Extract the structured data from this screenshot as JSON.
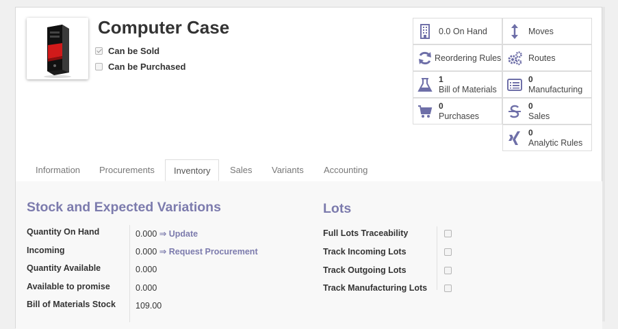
{
  "product": {
    "name": "Computer Case",
    "can_be_sold_label": "Can be Sold",
    "can_be_sold": true,
    "can_be_purchased_label": "Can be Purchased",
    "can_be_purchased": false
  },
  "smart_buttons": {
    "on_hand": "0.0 On Hand",
    "moves": "Moves",
    "reordering_rules": "Reordering Rules",
    "routes": "Routes",
    "bom_count": "1",
    "bom_label": "Bill of Materials",
    "manufacturing_count": "0",
    "manufacturing_label": "Manufacturing",
    "purchases_count": "0",
    "purchases_label": "Purchases",
    "sales_count": "0",
    "sales_label": "Sales",
    "analytic_count": "0",
    "analytic_label": "Analytic Rules"
  },
  "tabs": [
    "Information",
    "Procurements",
    "Inventory",
    "Sales",
    "Variants",
    "Accounting"
  ],
  "active_tab": "Inventory",
  "stock": {
    "title": "Stock and Expected Variations",
    "rows": [
      {
        "label": "Quantity On Hand",
        "value": "0.000",
        "link": "⇒ Update"
      },
      {
        "label": "Incoming",
        "value": "0.000",
        "link": "⇒ Request Procurement"
      },
      {
        "label": "Quantity Available",
        "value": "0.000"
      },
      {
        "label": "Available to promise",
        "value": "0.000"
      },
      {
        "label": "Bill of Materials Stock",
        "value": "109.00"
      }
    ]
  },
  "lots": {
    "title": "Lots",
    "rows": [
      {
        "label": "Full Lots Traceability",
        "checked": false
      },
      {
        "label": "Track Incoming Lots",
        "checked": false
      },
      {
        "label": "Track Outgoing Lots",
        "checked": false
      },
      {
        "label": "Track Manufacturing Lots",
        "checked": false
      }
    ]
  },
  "colors": {
    "accent": "#7c7bad",
    "icon": "#6e6fa8",
    "tower_red": "#d11a1a"
  }
}
